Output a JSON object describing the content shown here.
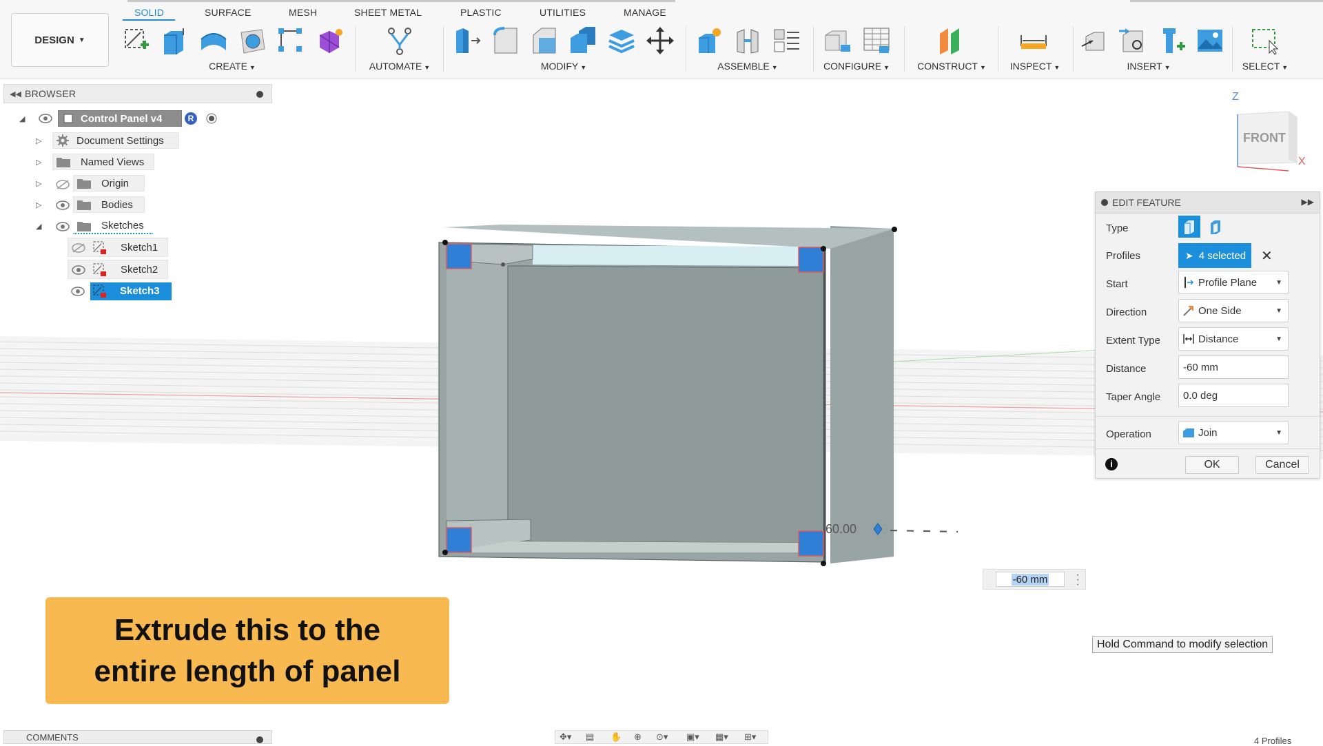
{
  "toolbar": {
    "workspace_label": "DESIGN",
    "tabs": [
      "SOLID",
      "SURFACE",
      "MESH",
      "SHEET METAL",
      "PLASTIC",
      "UTILITIES",
      "MANAGE"
    ],
    "active_tab": "SOLID",
    "groups": [
      "CREATE",
      "AUTOMATE",
      "MODIFY",
      "ASSEMBLE",
      "CONFIGURE",
      "CONSTRUCT",
      "INSPECT",
      "INSERT",
      "SELECT"
    ]
  },
  "browser": {
    "title": "BROWSER",
    "items": [
      {
        "label": "Control Panel v4"
      },
      {
        "label": "Document Settings"
      },
      {
        "label": "Named Views"
      },
      {
        "label": "Origin"
      },
      {
        "label": "Bodies"
      },
      {
        "label": "Sketches"
      },
      {
        "label": "Sketch1"
      },
      {
        "label": "Sketch2"
      },
      {
        "label": "Sketch3"
      }
    ],
    "selected_item": "Sketch3",
    "root_badge": "R"
  },
  "comments": {
    "title": "COMMENTS"
  },
  "viewcube": {
    "face": "FRONT",
    "axis_z": "Z",
    "axis_x": "X"
  },
  "edit_feature": {
    "title": "EDIT FEATURE",
    "rows": {
      "type": "Type",
      "profiles": "Profiles",
      "start": "Start",
      "direction": "Direction",
      "extent_type": "Extent Type",
      "distance": "Distance",
      "taper_angle": "Taper Angle",
      "operation": "Operation"
    },
    "profiles_value": "4 selected",
    "start_value": "Profile Plane",
    "direction_value": "One Side",
    "extent_value": "Distance",
    "distance_value": "-60 mm",
    "taper_value": "0.0 deg",
    "operation_value": "Join",
    "ok_label": "OK",
    "cancel_label": "Cancel"
  },
  "canvas": {
    "dimension_label": "60.00",
    "distance_input": "-60 mm",
    "tooltip": "Hold Command to modify selection",
    "profiles_count": "4 Profiles"
  },
  "caption": {
    "line1": "Extrude this to the",
    "line2": "entire length of panel"
  },
  "colors": {
    "accent": "#1b8fdc",
    "caption_bg": "#f8b950",
    "body_grey": "#94a2a0",
    "profile_blue": "#2f7fd6"
  }
}
